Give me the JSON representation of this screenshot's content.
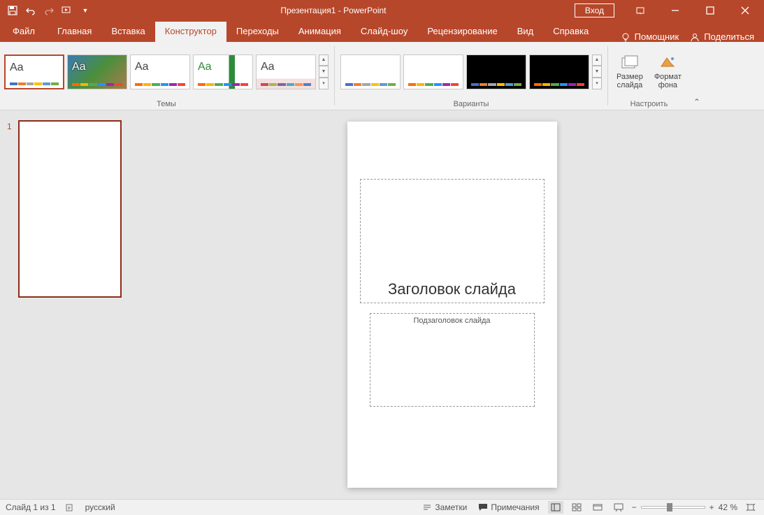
{
  "titlebar": {
    "title": "Презентация1 - PowerPoint",
    "login": "Вход"
  },
  "tabs": {
    "file": "Файл",
    "home": "Главная",
    "insert": "Вставка",
    "design": "Конструктор",
    "transitions": "Переходы",
    "animations": "Анимация",
    "slideshow": "Слайд-шоу",
    "review": "Рецензирование",
    "view": "Вид",
    "help": "Справка",
    "tellme": "Помощник",
    "share": "Поделиться"
  },
  "ribbon": {
    "themes_label": "Темы",
    "variants_label": "Варианты",
    "customize_label": "Настроить",
    "slide_size": "Размер\nслайда",
    "format_bg": "Формат\nфона",
    "aa": "Aa",
    "swatch_colors1": [
      "#4472c4",
      "#ed7d31",
      "#a5a5a5",
      "#ffc000",
      "#5b9bd5",
      "#70ad47"
    ],
    "swatch_colors2": [
      "#ff6b00",
      "#ffb300",
      "#4caf50",
      "#2196f3",
      "#9c27b0",
      "#f44336"
    ],
    "swatch_colors3": [
      "#c0504d",
      "#9bbb59",
      "#8064a2",
      "#4bacc6",
      "#f79646",
      "#4f81bd"
    ]
  },
  "thumbs": {
    "n1": "1"
  },
  "slide": {
    "title_ph": "Заголовок слайда",
    "sub_ph": "Подзаголовок слайда"
  },
  "status": {
    "slide_count": "Слайд 1 из 1",
    "lang": "русский",
    "notes": "Заметки",
    "comments": "Примечания",
    "zoom": "42 %"
  }
}
